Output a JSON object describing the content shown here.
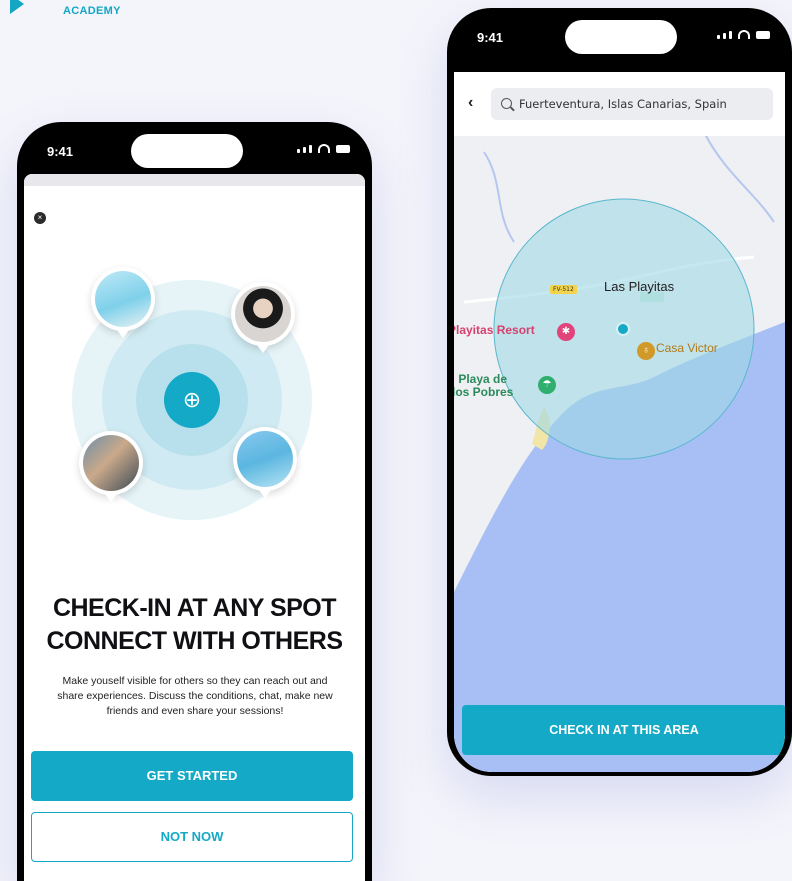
{
  "brand": {
    "name": "ACADEMY"
  },
  "left_phone": {
    "status_time": "9:41",
    "headline_line1": "CHECK-IN AT ANY SPOT",
    "headline_line2": "CONNECT WITH OTHERS",
    "description": "Make youself visible for others so they can reach out and share experiences. Discuss the conditions, chat, make new friends and even share your sessions!",
    "primary_button": "GET STARTED",
    "secondary_button": "NOT NOW",
    "icons": {
      "close": "×",
      "center_pin": "⊕"
    }
  },
  "right_phone": {
    "status_time": "9:41",
    "search": {
      "value": "Fuerteventura, Islas Canarias, Spain"
    },
    "back_glyph": "‹",
    "map_labels": {
      "town": "Las Playitas",
      "road": "FV-512",
      "resort": "Playitas Resort",
      "restaurant": "Casa Victor",
      "beach_line1": "Playa de",
      "beach_line2": "los Pobres"
    },
    "poi_glyphs": {
      "resort": "✱",
      "restaurant": "♁",
      "beach": "☂"
    },
    "action_button": "CHECK IN AT THIS AREA"
  },
  "colors": {
    "accent": "#14a9c6",
    "sea": "#a8bff5",
    "radius_fill": "#9fd9e6"
  }
}
